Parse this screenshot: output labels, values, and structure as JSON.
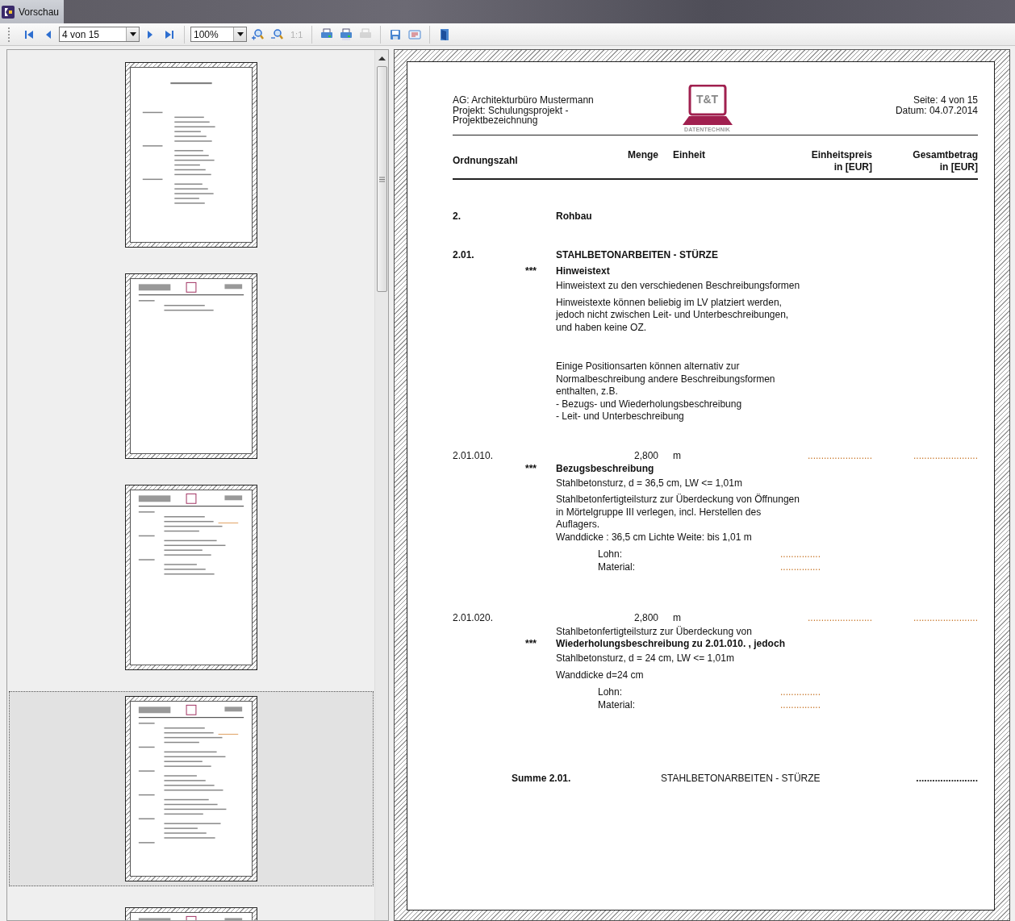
{
  "window": {
    "title": "Vorschau"
  },
  "toolbar": {
    "page_select": {
      "value": "4 von 15"
    },
    "zoom_select": {
      "value": "100%"
    },
    "actual_size": {
      "label": "1:1",
      "disabled": true
    },
    "buttons": [
      {
        "disabled": false
      },
      {
        "disabled": false
      },
      {
        "disabled": false
      },
      {
        "disabled": false
      },
      {
        "disabled": false
      },
      {
        "disabled": false
      },
      {
        "disabled": false
      },
      {
        "disabled": false
      },
      {
        "disabled": true
      },
      {
        "disabled": false
      },
      {
        "disabled": false
      },
      {
        "disabled": false
      }
    ]
  },
  "thumbnails": [
    {
      "selected": false
    },
    {
      "selected": false
    },
    {
      "selected": false
    },
    {
      "selected": true
    },
    {
      "selected": false
    }
  ],
  "document": {
    "header": {
      "left_lines": [
        "AG: Architekturbüro Mustermann",
        "Projekt: Schulungsprojekt -",
        "Projektbezeichnung"
      ],
      "logo": {
        "text": "T&T",
        "subtitle": "DATENTECHNIK"
      },
      "right_lines": [
        "Seite: 4 von 15",
        "Datum: 04.07.2014"
      ]
    },
    "columns": {
      "number": "Ordnungszahl",
      "quantity": "Menge",
      "unit": "Einheit",
      "unit_price": [
        "Einheitspreis",
        "in [EUR]"
      ],
      "total": [
        "Gesamtbetrag",
        "in [EUR]"
      ]
    },
    "blocks": [
      {
        "rows": [
          {
            "kind": "title",
            "oz": "2.",
            "text": "Rohbau"
          }
        ]
      },
      {
        "rows": [
          {
            "kind": "title",
            "oz": "2.01.",
            "text": "STAHLBETONARBEITEN - STÜRZE"
          },
          {
            "kind": "stars_title",
            "stars": "***",
            "text": "Hinweistext"
          },
          {
            "kind": "para",
            "lines": [
              "Hinweistext zu den verschiedenen Beschreibungsformen"
            ]
          },
          {
            "kind": "para",
            "lines": [
              "Hinweistexte können beliebig im LV platziert werden,",
              "jedoch nicht zwischen Leit- und Unterbeschreibungen,",
              "und haben keine OZ."
            ]
          }
        ]
      },
      {
        "rows": [
          {
            "kind": "para",
            "lines": [
              "Einige Positionsarten können alternativ zur",
              "Normalbeschreibung andere Beschreibungsformen",
              "enthalten, z.B.",
              "- Bezugs- und Wiederholungsbeschreibung",
              "- Leit- und Unterbeschreibung"
            ]
          }
        ]
      },
      {
        "rows": [
          {
            "kind": "position",
            "oz": "2.01.010.",
            "quantity": "2,800",
            "unit": "m",
            "unit_price": "........................",
            "total": "........................"
          },
          {
            "kind": "stars_title",
            "stars": "***",
            "text": "Bezugsbeschreibung"
          },
          {
            "kind": "para",
            "lines": [
              "Stahlbetonsturz, d = 36,5 cm, LW <= 1,01m"
            ]
          },
          {
            "kind": "para",
            "lines": [
              "Stahlbetonfertigteilsturz zur Überdeckung von Öffnungen",
              "in Mörtelgruppe III verlegen, incl. Herstellen des",
              "Auflagers.",
              "Wanddicke : 36,5 cm Lichte Weite: bis 1,01 m"
            ]
          },
          {
            "kind": "cost",
            "label": "Lohn:",
            "value": "..............."
          },
          {
            "kind": "cost",
            "label": "Material:",
            "value": "..............."
          }
        ]
      },
      {
        "rows": [
          {
            "kind": "position",
            "oz": "2.01.020.",
            "quantity": "2,800",
            "unit": "m",
            "unit_price": "........................",
            "total": "........................"
          },
          {
            "kind": "plain",
            "lines": [
              "Stahlbetonfertigteilsturz zur Überdeckung von"
            ]
          },
          {
            "kind": "stars_title",
            "stars": "***",
            "text": "Wiederholungsbeschreibung zu 2.01.010. , jedoch"
          },
          {
            "kind": "para",
            "lines": [
              "Stahlbetonsturz, d = 24 cm, LW <= 1,01m"
            ]
          },
          {
            "kind": "para",
            "lines": [
              "Wanddicke d=24 cm"
            ]
          },
          {
            "kind": "cost",
            "label": "Lohn:",
            "value": "..............."
          },
          {
            "kind": "cost",
            "label": "Material:",
            "value": "..............."
          }
        ]
      },
      {
        "rows": [
          {
            "kind": "sum",
            "label": "Summe 2.01.",
            "text": "STAHLBETONARBEITEN - STÜRZE",
            "total": "......................."
          }
        ]
      }
    ]
  }
}
